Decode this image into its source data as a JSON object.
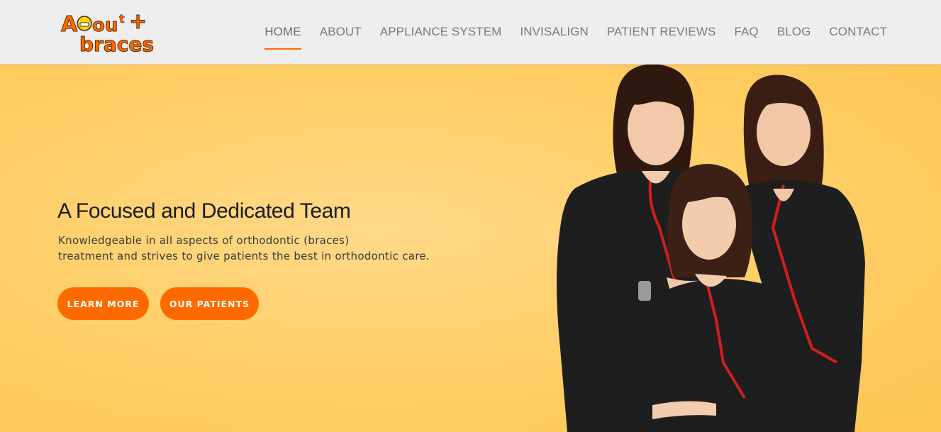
{
  "brand": {
    "logo_text_1": "About",
    "logo_text_2": "braces",
    "accent_color": "#ff6a00"
  },
  "nav": {
    "items": [
      {
        "label": "HOME",
        "active": true
      },
      {
        "label": "ABOUT",
        "active": false
      },
      {
        "label": "APPLIANCE SYSTEM",
        "active": false
      },
      {
        "label": "INVISALIGN",
        "active": false
      },
      {
        "label": "PATIENT REVIEWS",
        "active": false
      },
      {
        "label": "FAQ",
        "active": false
      },
      {
        "label": "BLOG",
        "active": false
      },
      {
        "label": "CONTACT",
        "active": false
      }
    ]
  },
  "hero": {
    "headline": "A Focused and Dedicated Team",
    "sub_line_1": "Knowledgeable in all aspects of orthodontic (braces)",
    "sub_line_2": "treatment and strives to give patients the best in orthodontic care.",
    "buttons": {
      "learn_more": "LEARN MORE",
      "our_patients": "OUR PATIENTS"
    },
    "background_color": "#ffd36f",
    "image_subject": "three-team-members-in-black-scrubs"
  }
}
